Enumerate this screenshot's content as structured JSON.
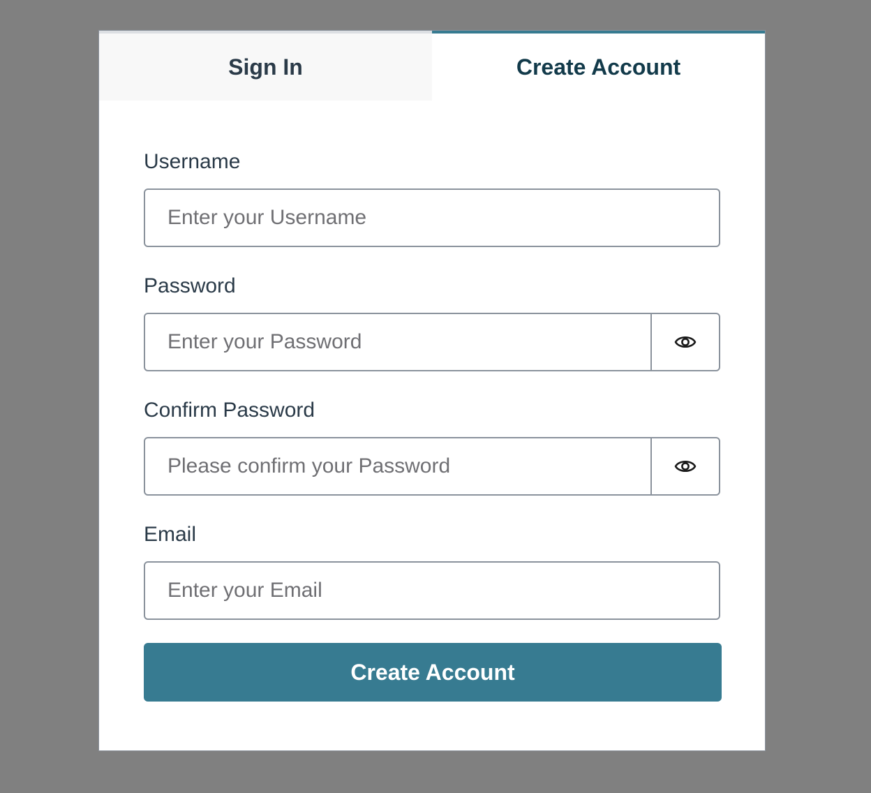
{
  "tabs": [
    {
      "label": "Sign In",
      "active": false
    },
    {
      "label": "Create Account",
      "active": true
    }
  ],
  "form": {
    "username": {
      "label": "Username",
      "placeholder": "Enter your Username",
      "value": ""
    },
    "password": {
      "label": "Password",
      "placeholder": "Enter your Password",
      "value": "",
      "toggle_icon": "eye-icon"
    },
    "confirm_password": {
      "label": "Confirm Password",
      "placeholder": "Please confirm your Password",
      "value": "",
      "toggle_icon": "eye-icon"
    },
    "email": {
      "label": "Email",
      "placeholder": "Enter your Email",
      "value": ""
    },
    "submit_label": "Create Account"
  },
  "colors": {
    "background": "#808080",
    "accent": "#377b91",
    "text": "#2a3a48",
    "inactive_tab_bg": "#f8f8f8",
    "border": "#8a929c"
  }
}
